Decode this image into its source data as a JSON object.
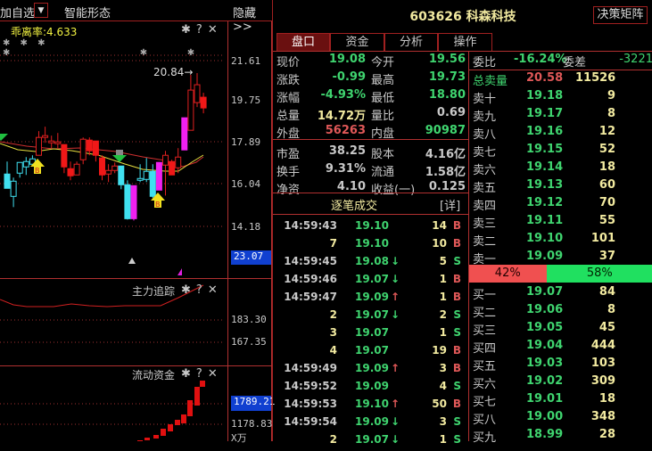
{
  "topbar": {
    "add_watch": "加自选",
    "pattern": "智能形态",
    "hide": "隐藏>>"
  },
  "main_chart": {
    "indicator": "乖离率:4.633",
    "peak_label": "20.84→",
    "axis": [
      "21.61",
      "19.75",
      "17.89",
      "16.04",
      "14.18"
    ],
    "axis_highlight": "23.07",
    "candles": [
      [
        16.85,
        16.29,
        15.65,
        15.65,
        "cf"
      ],
      [
        16.13,
        15.97,
        15.29,
        14.81,
        "ch"
      ],
      [
        16.81,
        16.81,
        16.33,
        16.13,
        "ch"
      ],
      [
        17.05,
        16.85,
        16.61,
        16.25,
        "ch"
      ],
      [
        17.13,
        16.97,
        16.73,
        16.73,
        "ch"
      ],
      [
        18.21,
        17.93,
        17.13,
        17.13,
        "rh"
      ],
      [
        18.41,
        18.01,
        17.93,
        17.69,
        "rh"
      ],
      [
        18.01,
        17.77,
        17.69,
        17.45,
        "rh"
      ],
      [
        18.13,
        17.73,
        17.65,
        17.45,
        "rh"
      ],
      [
        17.61,
        17.61,
        16.61,
        16.33,
        "rf"
      ],
      [
        16.85,
        16.53,
        16.21,
        16.01,
        "rf"
      ],
      [
        16.85,
        16.73,
        16.25,
        16.25,
        "rh"
      ],
      [
        17.93,
        17.85,
        16.93,
        16.73,
        "rh"
      ],
      [
        17.93,
        17.81,
        17.33,
        17.13,
        "rf"
      ],
      [
        17.77,
        17.77,
        17.13,
        16.85,
        "rf"
      ],
      [
        17.13,
        17.01,
        16.25,
        16.01,
        "rf"
      ],
      [
        16.73,
        16.45,
        16.29,
        15.93,
        "rh"
      ],
      [
        16.81,
        16.65,
        16.45,
        16.33,
        "rh"
      ],
      [
        16.65,
        16.65,
        15.81,
        15.61,
        "cf"
      ],
      [
        16.01,
        15.81,
        14.29,
        14.25,
        "cf"
      ],
      [
        15.77,
        15.77,
        14.29,
        14.21,
        "m"
      ],
      [
        16.73,
        16.09,
        16.01,
        15.93,
        "ch"
      ],
      [
        17.01,
        16.41,
        16.05,
        15.93,
        "ch"
      ],
      [
        16.73,
        16.41,
        15.29,
        15.21,
        "cf"
      ],
      [
        16.81,
        16.81,
        15.57,
        15.57,
        "m"
      ],
      [
        17.33,
        17.13,
        16.69,
        15.33,
        "rh"
      ],
      [
        16.93,
        16.85,
        16.25,
        16.25,
        "rf"
      ],
      [
        17.45,
        17.05,
        16.57,
        16.33,
        "rh"
      ],
      [
        18.81,
        18.81,
        17.37,
        17.37,
        "m"
      ],
      [
        20.73,
        20.05,
        18.25,
        18.25,
        "rh"
      ],
      [
        20.81,
        20.29,
        19.49,
        19.29,
        "rh"
      ],
      [
        19.93,
        19.73,
        19.25,
        19.01,
        "rf"
      ]
    ],
    "buy_marker": "B",
    "sell_marker": "S"
  },
  "tracking": {
    "title": "主力追踪",
    "axis": [
      "183.30",
      "167.35"
    ]
  },
  "flow": {
    "title": "流动资金",
    "axis": [
      "1789.21",
      "1178.83"
    ],
    "unit": "X万"
  },
  "header": {
    "code_name": "603626 科森科技",
    "matrix_button": "决策矩阵"
  },
  "tabs": [
    "盘口",
    "资金",
    "分析",
    "操作"
  ],
  "quote": [
    [
      "现价",
      "19.08",
      "今开",
      "19.56",
      "g",
      "g"
    ],
    [
      "涨跌",
      "-0.99",
      "最高",
      "19.73",
      "g",
      "g"
    ],
    [
      "涨幅",
      "-4.93%",
      "最低",
      "18.80",
      "g",
      "g"
    ],
    [
      "总量",
      "14.72万",
      "量比",
      "0.69",
      "y",
      "w"
    ],
    [
      "外盘",
      "56263",
      "内盘",
      "90987",
      "r",
      "g"
    ],
    [
      "市盈",
      "38.25",
      "股本",
      "4.16亿",
      "w",
      "w"
    ],
    [
      "换手",
      "9.31%",
      "流通",
      "1.58亿",
      "w",
      "w"
    ],
    [
      "净资",
      "4.10",
      "收益(一)",
      "0.125",
      "w",
      "w"
    ]
  ],
  "trades_title": "逐笔成交",
  "trades_detail": "[详]",
  "trades": [
    [
      "14:59:43",
      "19.10",
      "",
      "14",
      "B"
    ],
    [
      "7",
      "19.10",
      "",
      "10",
      "B"
    ],
    [
      "14:59:45",
      "19.08",
      "↓",
      "5",
      "S"
    ],
    [
      "14:59:46",
      "19.07",
      "↓",
      "1",
      "B"
    ],
    [
      "14:59:47",
      "19.09",
      "↑",
      "1",
      "B"
    ],
    [
      "2",
      "19.07",
      "↓",
      "2",
      "S"
    ],
    [
      "3",
      "19.07",
      "",
      "1",
      "S"
    ],
    [
      "4",
      "19.07",
      "",
      "19",
      "B"
    ],
    [
      "14:59:49",
      "19.09",
      "↑",
      "3",
      "B"
    ],
    [
      "14:59:52",
      "19.09",
      "",
      "4",
      "S"
    ],
    [
      "14:59:53",
      "19.10",
      "↑",
      "50",
      "B"
    ],
    [
      "14:59:54",
      "19.09",
      "↓",
      "3",
      "S"
    ],
    [
      "2",
      "19.07",
      "↓",
      "1",
      "S"
    ]
  ],
  "book": {
    "ratio_label": "委比",
    "ratio": "-16.24%",
    "diff_label": "委差",
    "diff": "-3221",
    "total_sell_label": "总卖量",
    "total_sell_price": "20.58",
    "total_sell_vol": "11526",
    "asks": [
      [
        "卖十",
        "19.18",
        "9"
      ],
      [
        "卖九",
        "19.17",
        "8"
      ],
      [
        "卖八",
        "19.16",
        "12"
      ],
      [
        "卖七",
        "19.15",
        "52"
      ],
      [
        "卖六",
        "19.14",
        "18"
      ],
      [
        "卖五",
        "19.13",
        "60"
      ],
      [
        "卖四",
        "19.12",
        "70"
      ],
      [
        "卖三",
        "19.11",
        "55"
      ],
      [
        "卖二",
        "19.10",
        "101"
      ],
      [
        "卖一",
        "19.09",
        "37"
      ]
    ],
    "buy_pct": "42%",
    "sell_pct": "58%",
    "buy_fraction": 0.42,
    "bids": [
      [
        "买一",
        "19.07",
        "84"
      ],
      [
        "买二",
        "19.06",
        "8"
      ],
      [
        "买三",
        "19.05",
        "45"
      ],
      [
        "买四",
        "19.04",
        "444"
      ],
      [
        "买五",
        "19.03",
        "103"
      ],
      [
        "买六",
        "19.02",
        "309"
      ],
      [
        "买七",
        "19.01",
        "18"
      ],
      [
        "买八",
        "19.00",
        "348"
      ],
      [
        "买九",
        "18.99",
        "28"
      ]
    ]
  }
}
